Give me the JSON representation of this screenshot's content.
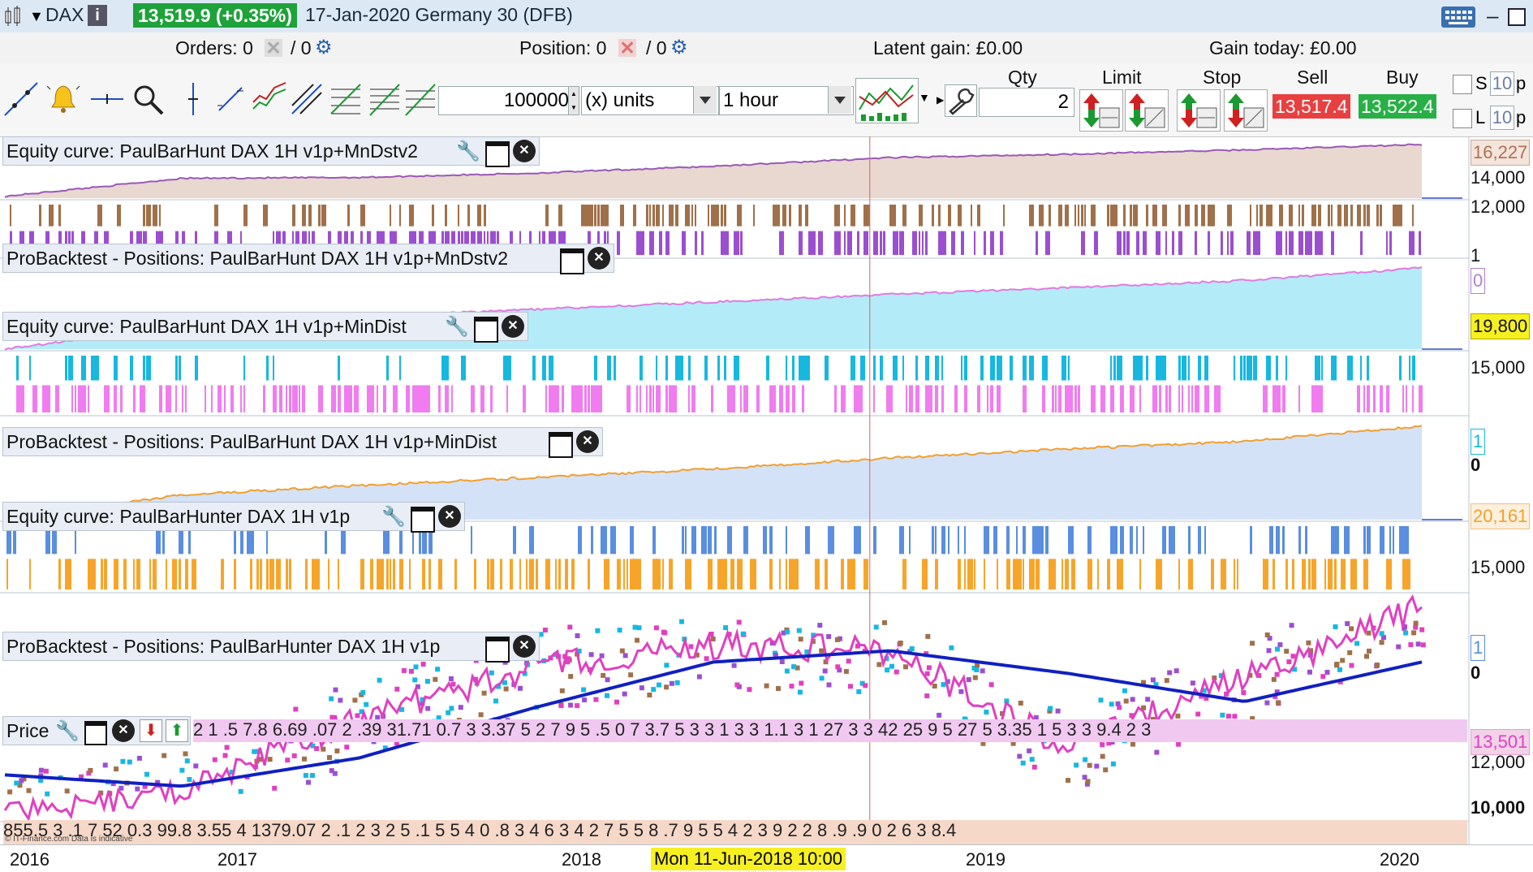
{
  "window": {
    "symbol": "DAX",
    "price_badge": "13,519.9 (+0.35%)",
    "date_instrument": "17-Jan-2020 Germany 30 (DFB)"
  },
  "infobar": {
    "orders": "Orders: 0",
    "orders_slash": "/ 0",
    "position": "Position: 0",
    "position_slash": "/ 0",
    "latent_gain": "Latent gain: £0.00",
    "gain_today": "Gain today: £0.00"
  },
  "toolbar": {
    "amount": "100000",
    "units": "(x) units",
    "timeframe": "1 hour",
    "qty_label": "Qty",
    "qty_value": "2",
    "limit_label": "Limit",
    "stop_label": "Stop",
    "sell_label": "Sell",
    "buy_label": "Buy",
    "sell_price": "13,517.4",
    "buy_price": "13,522.4",
    "s_label": "S",
    "l_label": "L",
    "s_value": "10",
    "l_value": "10",
    "s_suffix": "p",
    "l_suffix": "p"
  },
  "panels": [
    {
      "title": "Equity curve: PaulBarHunt DAX 1H v1p+MnDstv2",
      "axis_ticks": [
        "14,000",
        "12,000"
      ],
      "last_value": "16,227"
    },
    {
      "title": "ProBacktest - Positions: PaulBarHunt DAX 1H v1p+MnDstv2",
      "axis_ticks": [
        "1",
        "0"
      ]
    },
    {
      "title": "Equity curve: PaulBarHunt DAX 1H v1p+MinDist",
      "axis_ticks": [
        "15,000"
      ],
      "last_value": "19,800"
    },
    {
      "title": "ProBacktest - Positions: PaulBarHunt DAX 1H v1p+MinDist",
      "axis_ticks": [
        "1",
        "0"
      ]
    },
    {
      "title": "Equity curve: PaulBarHunter DAX 1H v1p",
      "axis_ticks": [
        "15,000"
      ],
      "last_value": "20,161"
    },
    {
      "title": "ProBacktest - Positions: PaulBarHunter DAX 1H v1p",
      "axis_ticks": [
        "1",
        "0"
      ]
    },
    {
      "title": "Price",
      "axis_ticks": [
        "12,000",
        "10,000"
      ],
      "last_value": "13,501"
    }
  ],
  "crosshair_label": "Mon 11-Jun-2018 10:00",
  "footer_note": "© IT-Finance.com  Data is indicative",
  "price_partial_top": "2 1 .5 7.8 6.69 .07 2 .39 31.71 0.7 3 3.37 5 2 7 9 5 .5 0 7 3.7 5 3 3 1 3 3 1.1 3 1 27 3 3 42 25 9 5 27 5 3.35 1 5 3 3 9.4 2 3",
  "price_partial_bottom": "855.5 3 .1 7 52 0.3 99.8 3.55 4 1379.07 2 .1 2 3 2 5 .1 5 5 4 0 .8 3 4 6 3 4 2 7 5 5 8 .7 9 5 5 4 2 3 9 2 2 8 .9 .9 0 2 6 3 8.4",
  "colors": {
    "title_bg": "#dce9f5",
    "price_green": "#1ea23a",
    "sell_red": "#e84040",
    "buy_green": "#28b046",
    "eq1_fill": "#e8d8d0",
    "eq1_line": "#9b59b6",
    "eq2_fill": "#b3ecf8",
    "eq2_line": "#e07be0",
    "eq3_fill": "#d4e2f8",
    "eq3_line": "#f0a030",
    "pos1_long": "#a0704a",
    "pos1_short": "#9b4fd0",
    "pos2_long": "#16b8e0",
    "pos2_short": "#f07cf0",
    "pos3_long": "#5a8ee0",
    "pos3_short": "#f7a52a",
    "ma_blue": "#1020c0",
    "ma_pink": "#e040c0"
  },
  "chart_data": [
    {
      "type": "area",
      "title": "Equity curve: PaulBarHunt DAX 1H v1p+MnDstv2",
      "x": [
        "2016",
        "2016.5",
        "2017",
        "2017.5",
        "2018",
        "2018.5",
        "2019",
        "2019.5",
        "2020"
      ],
      "values": [
        10200,
        12300,
        12400,
        12900,
        13700,
        14700,
        15100,
        15600,
        16227
      ],
      "ylim": [
        10000,
        16600
      ]
    },
    {
      "type": "area",
      "title": "Equity curve: PaulBarHunt DAX 1H v1p+MinDist",
      "x": [
        "2016",
        "2016.5",
        "2017",
        "2017.5",
        "2018",
        "2018.5",
        "2019",
        "2019.5",
        "2020"
      ],
      "values": [
        10000,
        12800,
        14000,
        14800,
        15700,
        16600,
        17400,
        18300,
        19800
      ],
      "ylim": [
        10000,
        20200
      ]
    },
    {
      "type": "area",
      "title": "Equity curve: PaulBarHunter DAX 1H v1p",
      "x": [
        "2016",
        "2016.5",
        "2017",
        "2017.5",
        "2018",
        "2018.5",
        "2019",
        "2019.5",
        "2020"
      ],
      "values": [
        10000,
        12700,
        13700,
        14600,
        15500,
        16700,
        17700,
        18500,
        20161
      ],
      "ylim": [
        10000,
        20600
      ]
    },
    {
      "type": "line",
      "title": "Price",
      "x": [
        "2016",
        "2016.5",
        "2017",
        "2017.5",
        "2018",
        "2018.5",
        "2019",
        "2019.5",
        "2020"
      ],
      "series": [
        {
          "values": [
            9800,
            10200,
            11500,
            12400,
            12800,
            12700,
            11000,
            12200,
            13501
          ]
        },
        {
          "values": [
            10500,
            10300,
            10800,
            11700,
            12500,
            12700,
            12300,
            11800,
            12500
          ]
        }
      ],
      "ylim": [
        9700,
        13700
      ]
    }
  ],
  "x_axis": [
    "2016",
    "2017",
    "2018",
    "2019",
    "2020"
  ]
}
